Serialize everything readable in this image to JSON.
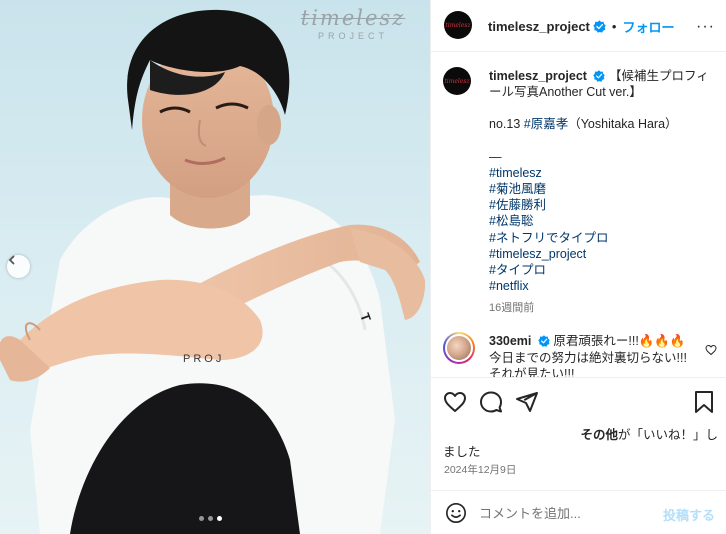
{
  "photo": {
    "watermark_main": "timelesz",
    "watermark_sub": "PROJECT",
    "shirt_text": "PROJ",
    "carousel_total": 3,
    "carousel_active": 3
  },
  "header": {
    "username": "timelesz_project",
    "follow_label": "フォロー",
    "separator": "•",
    "more": "···",
    "avatar_text": "timelesz"
  },
  "caption": {
    "username": "timelesz_project",
    "title": "【候補生プロフィール写真Another Cut ver.】",
    "line_no": "no.13",
    "line_tag": "#原嘉孝",
    "line_rest": "（Yoshitaka Hara）",
    "dash": "—",
    "hashtags": [
      "#timelesz",
      "#菊池風磨",
      "#佐藤勝利",
      "#松島聡",
      "#ネトフリでタイプロ",
      "#timelesz_project",
      "#タイプロ",
      "#netflix"
    ],
    "time_ago": "16週間前"
  },
  "comment": {
    "username": "330emi",
    "lines": [
      "原君頑張れー!!!🔥🔥🔥",
      "今日までの努力は絶対裏切らない!!!",
      "それが見たい!!!"
    ]
  },
  "likes": {
    "part_bold": "その他",
    "part_rest": "が「いいね！」し",
    "part_end": "ました"
  },
  "date": "2024年12月9日",
  "add_comment": {
    "placeholder": "コメントを追加...",
    "post_label": "投稿する"
  },
  "colors": {
    "accent": "#0095f6",
    "hashtag": "#00376b",
    "muted": "#737373",
    "post_disabled": "#b2dffc"
  }
}
